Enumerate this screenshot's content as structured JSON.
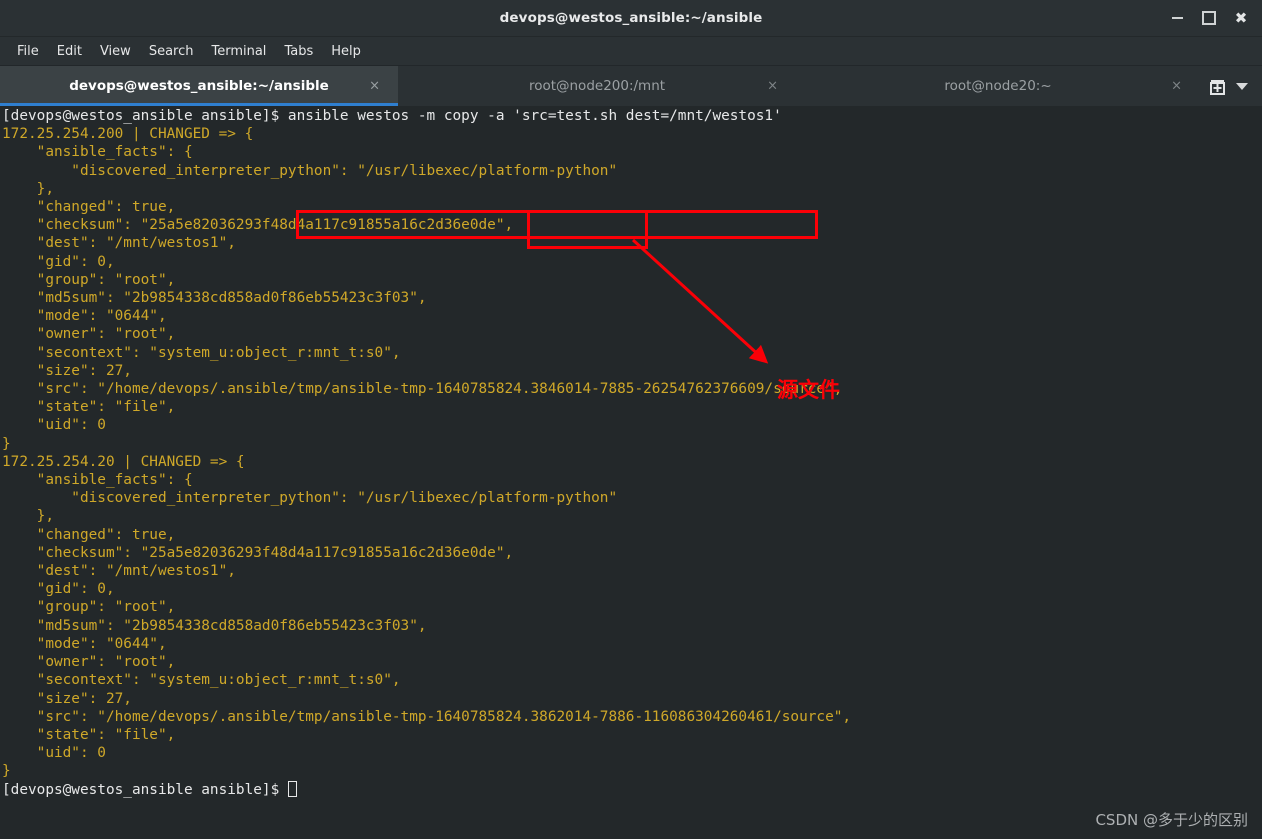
{
  "window": {
    "title": "devops@westos_ansible:~/ansible",
    "controls": {
      "minimize": "minimize-button",
      "maximize": "maximize-button",
      "close": "close-button"
    }
  },
  "menubar": {
    "items": [
      {
        "label": "File"
      },
      {
        "label": "Edit"
      },
      {
        "label": "View"
      },
      {
        "label": "Search"
      },
      {
        "label": "Terminal"
      },
      {
        "label": "Tabs"
      },
      {
        "label": "Help"
      }
    ]
  },
  "tabs": {
    "items": [
      {
        "label": "devops@westos_ansible:~/ansible",
        "active": true,
        "close": "×"
      },
      {
        "label": "root@node200:/mnt",
        "active": false,
        "close": "×"
      },
      {
        "label": "root@node20:~",
        "active": false,
        "close": "×"
      }
    ],
    "new_tab_icon": "new-tab-icon",
    "dropdown_icon": "chevron-down-icon"
  },
  "terminal": {
    "prompt": "[devops@westos_ansible ansible]$ ",
    "command": "ansible westos -m copy -a 'src=test.sh dest=/mnt/westos1'",
    "lines": [
      {
        "text": "[devops@westos_ansible ansible]$ ansible westos -m copy -a 'src=test.sh dest=/mnt/westos1'",
        "color": "white"
      },
      {
        "text": "172.25.254.200 | CHANGED => {",
        "color": "yellow"
      },
      {
        "text": "    \"ansible_facts\": {",
        "color": "yellow"
      },
      {
        "text": "        \"discovered_interpreter_python\": \"/usr/libexec/platform-python\"",
        "color": "yellow"
      },
      {
        "text": "    },",
        "color": "yellow"
      },
      {
        "text": "    \"changed\": true,",
        "color": "yellow"
      },
      {
        "text": "    \"checksum\": \"25a5e82036293f48d4a117c91855a16c2d36e0de\",",
        "color": "yellow"
      },
      {
        "text": "    \"dest\": \"/mnt/westos1\",",
        "color": "yellow"
      },
      {
        "text": "    \"gid\": 0,",
        "color": "yellow"
      },
      {
        "text": "    \"group\": \"root\",",
        "color": "yellow"
      },
      {
        "text": "    \"md5sum\": \"2b9854338cd858ad0f86eb55423c3f03\",",
        "color": "yellow"
      },
      {
        "text": "    \"mode\": \"0644\",",
        "color": "yellow"
      },
      {
        "text": "    \"owner\": \"root\",",
        "color": "yellow"
      },
      {
        "text": "    \"secontext\": \"system_u:object_r:mnt_t:s0\",",
        "color": "yellow"
      },
      {
        "text": "    \"size\": 27,",
        "color": "yellow"
      },
      {
        "text": "    \"src\": \"/home/devops/.ansible/tmp/ansible-tmp-1640785824.3846014-7885-26254762376609/source\",",
        "color": "yellow"
      },
      {
        "text": "    \"state\": \"file\",",
        "color": "yellow"
      },
      {
        "text": "    \"uid\": 0",
        "color": "yellow"
      },
      {
        "text": "}",
        "color": "yellow"
      },
      {
        "text": "172.25.254.20 | CHANGED => {",
        "color": "yellow"
      },
      {
        "text": "    \"ansible_facts\": {",
        "color": "yellow"
      },
      {
        "text": "        \"discovered_interpreter_python\": \"/usr/libexec/platform-python\"",
        "color": "yellow"
      },
      {
        "text": "    },",
        "color": "yellow"
      },
      {
        "text": "    \"changed\": true,",
        "color": "yellow"
      },
      {
        "text": "    \"checksum\": \"25a5e82036293f48d4a117c91855a16c2d36e0de\",",
        "color": "yellow"
      },
      {
        "text": "    \"dest\": \"/mnt/westos1\",",
        "color": "yellow"
      },
      {
        "text": "    \"gid\": 0,",
        "color": "yellow"
      },
      {
        "text": "    \"group\": \"root\",",
        "color": "yellow"
      },
      {
        "text": "    \"md5sum\": \"2b9854338cd858ad0f86eb55423c3f03\",",
        "color": "yellow"
      },
      {
        "text": "    \"mode\": \"0644\",",
        "color": "yellow"
      },
      {
        "text": "    \"owner\": \"root\",",
        "color": "yellow"
      },
      {
        "text": "    \"secontext\": \"system_u:object_r:mnt_t:s0\",",
        "color": "yellow"
      },
      {
        "text": "    \"size\": 27,",
        "color": "yellow"
      },
      {
        "text": "    \"src\": \"/home/devops/.ansible/tmp/ansible-tmp-1640785824.3862014-7886-116086304260461/source\",",
        "color": "yellow"
      },
      {
        "text": "    \"state\": \"file\",",
        "color": "yellow"
      },
      {
        "text": "    \"uid\": 0",
        "color": "yellow"
      },
      {
        "text": "}",
        "color": "yellow"
      },
      {
        "text": "[devops@westos_ansible ansible]$ ",
        "color": "white"
      }
    ]
  },
  "annotations": {
    "highlight_command_label": "ansible westos -m copy -a 'src=test.sh dest=/mnt/westos1'",
    "highlight_src_label": "'src=test.sh",
    "callout_text": "源文件",
    "color": "#fb0007"
  },
  "watermark": {
    "text": "CSDN @多于少的区别"
  }
}
